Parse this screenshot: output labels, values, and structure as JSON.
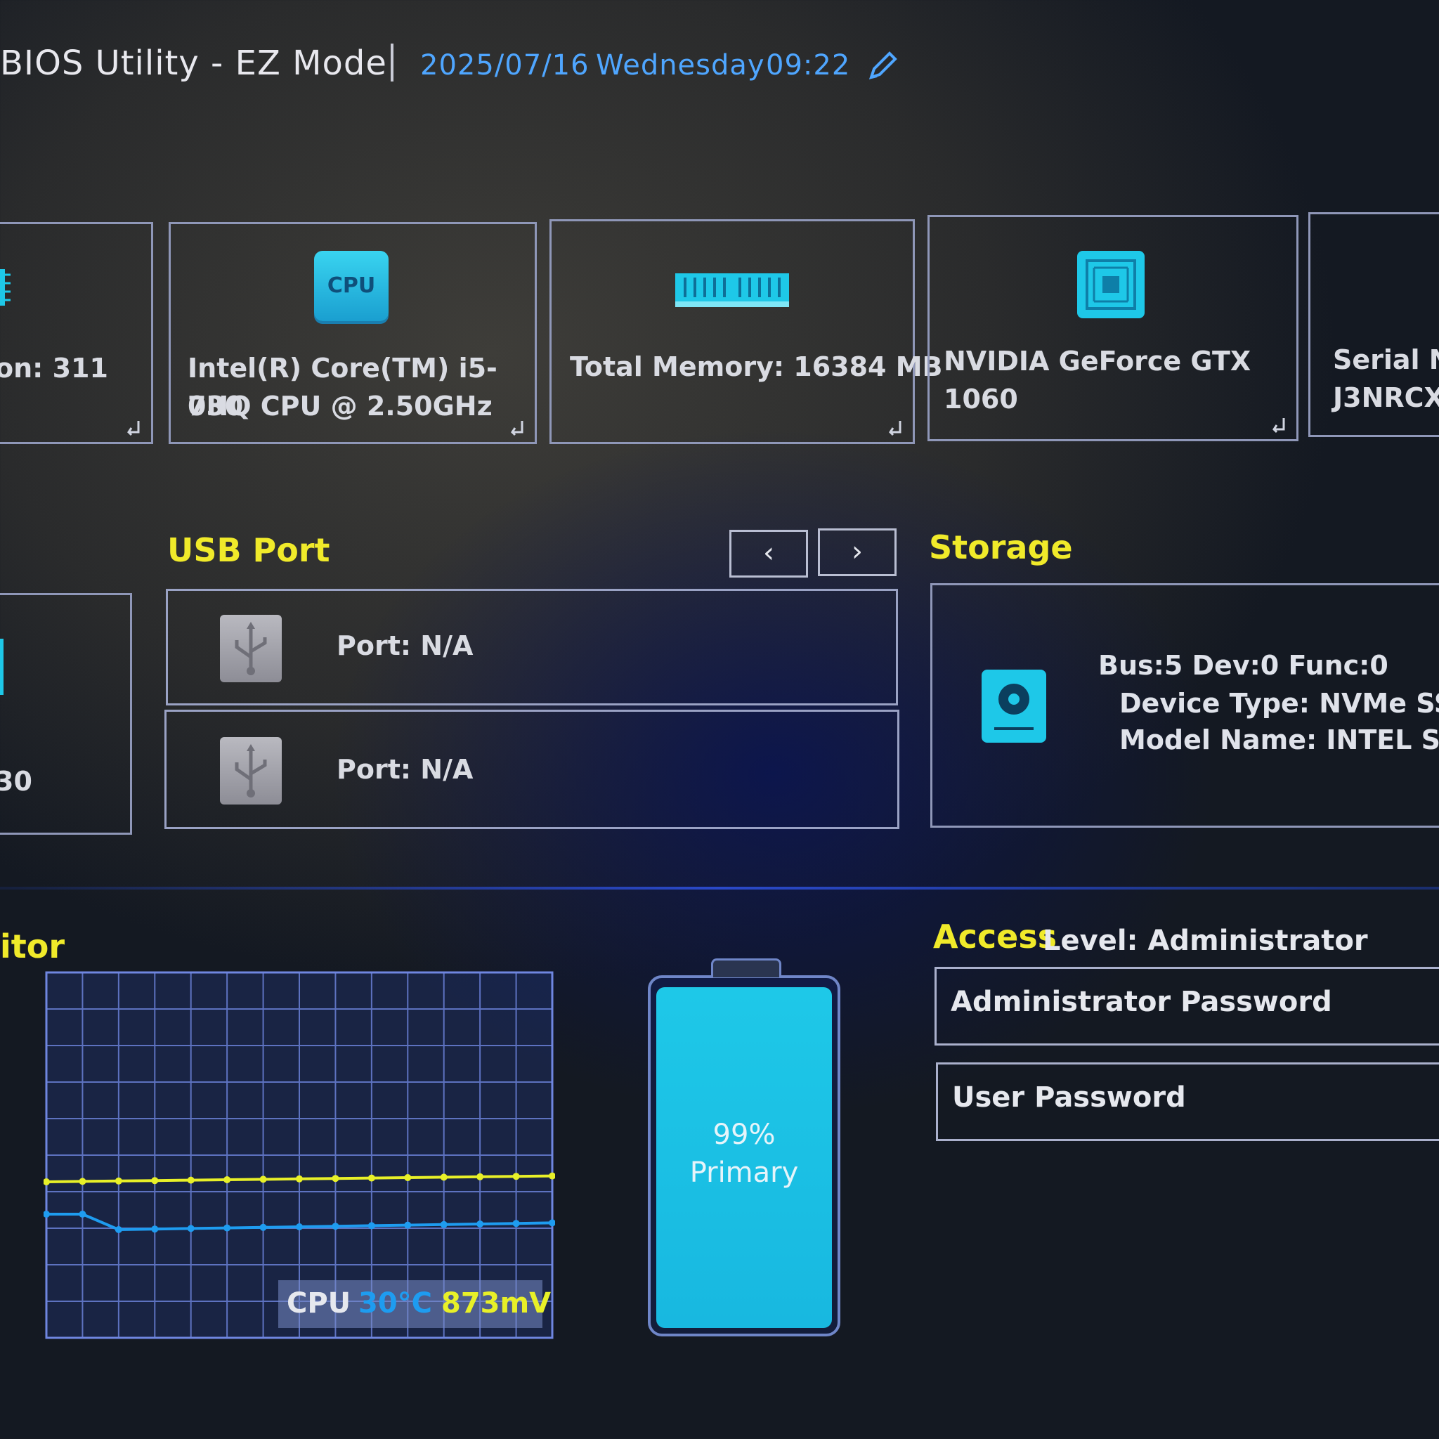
{
  "header": {
    "title": "BIOS Utility - EZ Mode",
    "date": "2025/07/16",
    "weekday": "Wednesday",
    "time": "09:22"
  },
  "info_cards": [
    {
      "text_line1": "on: 311",
      "icon": "chip-icon"
    },
    {
      "text_line1": "Intel(R) Core(TM) i5-730",
      "text_line2": "0HQ CPU @ 2.50GHz",
      "icon": "cpu-icon",
      "icon_label": "CPU"
    },
    {
      "text_line1": "Total Memory: 16384 MB",
      "icon": "memory-icon"
    },
    {
      "text_line1": "NVIDIA GeForce GTX",
      "text_line2": "1060",
      "icon": "gpu-icon"
    },
    {
      "text_line1": "Serial N",
      "text_line2": "J3NRCX"
    }
  ],
  "usb": {
    "title": "USB Port",
    "prev_label": "‹",
    "next_label": "›",
    "ports": [
      {
        "label": "Port: N/A"
      },
      {
        "label": "Port: N/A"
      }
    ]
  },
  "left_partial": {
    "value": "30"
  },
  "storage": {
    "title": "Storage",
    "bus": "Bus:5 Dev:0 Func:0",
    "device_type": "Device Type: NVMe SSD",
    "model_name": "Model Name: INTEL SSD"
  },
  "monitor": {
    "title": "itor",
    "cpu_label": "CPU",
    "cpu_temp": "30°C",
    "cpu_voltage": "873mV"
  },
  "battery": {
    "percent": "99%",
    "label": "Primary",
    "level": 0.99
  },
  "access": {
    "title": "Access",
    "level": "Level: Administrator",
    "admin_password": "Administrator Password",
    "user_password": "User Password"
  },
  "colors": {
    "accent_yellow": "#f0ea2a",
    "accent_blue": "#4fa6ff",
    "cyan": "#1ec8e8",
    "line_yellow": "#e8f028",
    "line_blue": "#1e9cf0"
  }
}
